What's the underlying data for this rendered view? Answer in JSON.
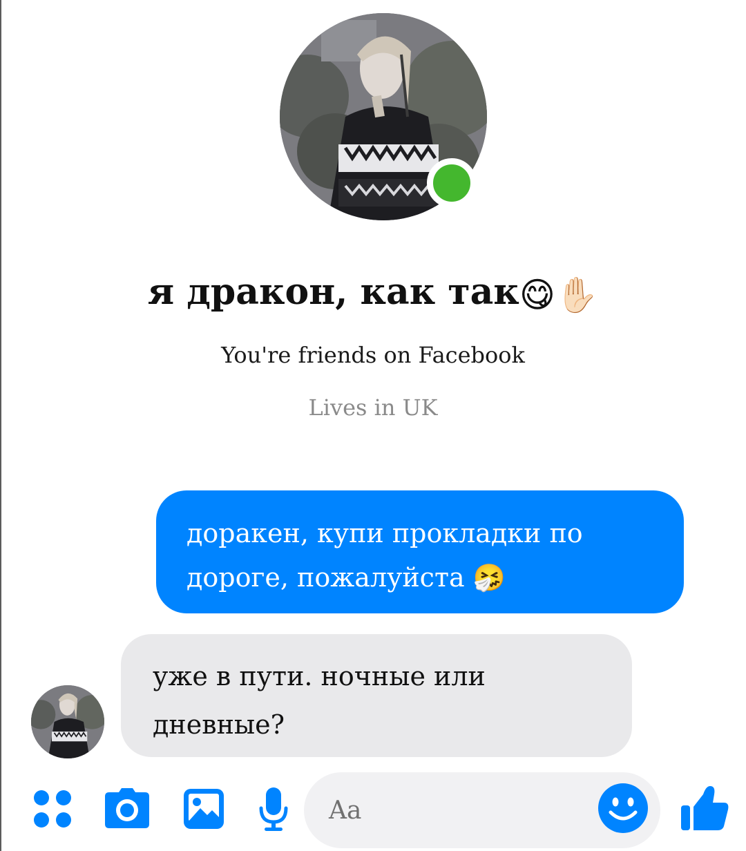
{
  "profile": {
    "name": "я дракон, как так",
    "name_emojis": "😋✋🏻",
    "friends_text": "You're friends on Facebook",
    "location_text": "Lives in UK",
    "online": true
  },
  "messages": [
    {
      "direction": "outgoing",
      "text": "доракен, купи прокладки по дороге, пожалуйста",
      "emoji": "🤧"
    },
    {
      "direction": "incoming",
      "text": "уже в пути. ночные или дневные?"
    }
  ],
  "composer": {
    "placeholder": "Aa",
    "icons": [
      "apps-icon",
      "camera-icon",
      "gallery-icon",
      "microphone-icon",
      "emoji-icon",
      "thumbs-up-icon"
    ]
  },
  "colors": {
    "accent": "#0084ff",
    "online": "#44b72e",
    "incoming_bubble": "#e9e9eb",
    "input_bg": "#f1f1f3"
  }
}
